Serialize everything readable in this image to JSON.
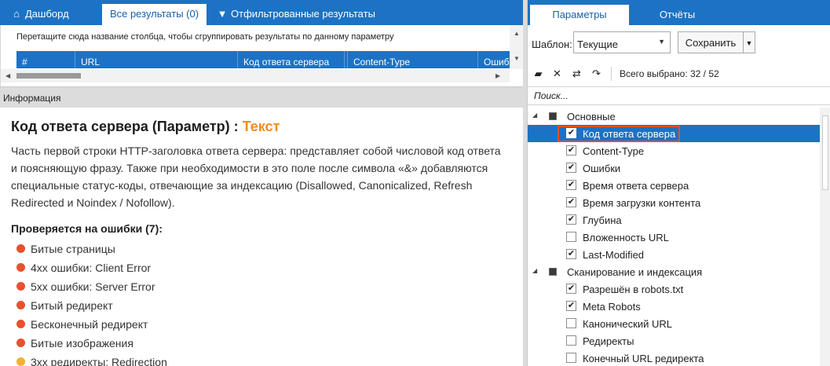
{
  "left_tabs": {
    "dashboard": "Дашборд",
    "all_results": "Все результаты (0)",
    "filtered": "Отфильтрованные результаты"
  },
  "grid": {
    "group_hint": "Перетащите сюда название столбца, чтобы сгруппировать результаты по данному параметру",
    "columns": [
      "#",
      "URL",
      "Код ответа сервера",
      "Content-Type",
      "Ошиб"
    ]
  },
  "info_panel": {
    "header": "Информация",
    "title_prefix": "Код ответа сервера (Параметр) : ",
    "title_type": "Текст",
    "description": "Часть первой строки HTTP-заголовка ответа сервера: представляет собой числовой код ответа и поясняющую фразу. Также при необходимости в это поле после символа «&» добавляются специальные статус-коды, отвечающие за индексацию (Disallowed, Canonicalized, Refresh Redirected и Noindex / Nofollow).",
    "checks_heading": "Проверяется на ошибки (7):",
    "checks": [
      {
        "label": "Битые страницы",
        "color": "#e8512d"
      },
      {
        "label": "4xx ошибки: Client Error",
        "color": "#e8512d"
      },
      {
        "label": "5xx ошибки: Server Error",
        "color": "#e8512d"
      },
      {
        "label": "Битый редирект",
        "color": "#e8512d"
      },
      {
        "label": "Бесконечный редирект",
        "color": "#e8512d"
      },
      {
        "label": "Битые изображения",
        "color": "#e8512d"
      },
      {
        "label": "3xx редиректы: Redirection",
        "color": "#f2b233"
      }
    ]
  },
  "right_tabs": {
    "params": "Параметры",
    "reports": "Отчёты"
  },
  "template": {
    "label": "Шаблон:",
    "value": "Текущие",
    "save": "Сохранить"
  },
  "toolbar": {
    "total": "Всего выбрано: 32 / 52"
  },
  "search": {
    "placeholder": "Поиск..."
  },
  "tree": {
    "group_main": "Основные",
    "main_items": [
      {
        "label": "Код ответа сервера",
        "checked": true
      },
      {
        "label": "Content-Type",
        "checked": true
      },
      {
        "label": "Ошибки",
        "checked": true
      },
      {
        "label": "Время ответа сервера",
        "checked": true
      },
      {
        "label": "Время загрузки контента",
        "checked": true
      },
      {
        "label": "Глубина",
        "checked": true
      },
      {
        "label": "Вложенность URL",
        "checked": false
      },
      {
        "label": "Last-Modified",
        "checked": true
      }
    ],
    "group_scan": "Сканирование и индексация",
    "scan_items": [
      {
        "label": "Разрешён в robots.txt",
        "checked": true
      },
      {
        "label": "Meta Robots",
        "checked": true
      },
      {
        "label": "Канонический URL",
        "checked": false
      },
      {
        "label": "Редиректы",
        "checked": false
      },
      {
        "label": "Конечный URL редиректа",
        "checked": false
      }
    ]
  },
  "colors": {
    "accent": "#1c72c4",
    "type_highlight": "#f28c1c",
    "selection_outline": "#e0522a"
  }
}
